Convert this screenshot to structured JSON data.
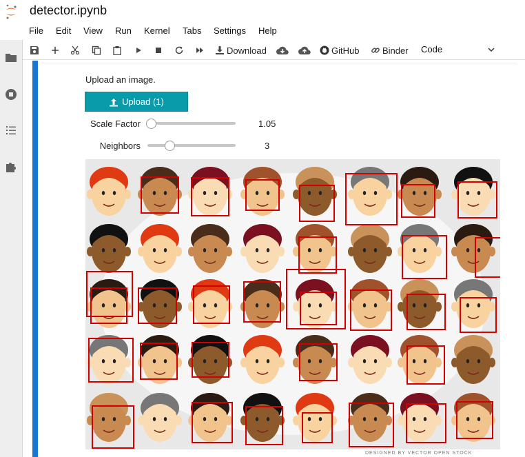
{
  "notebook": {
    "name": "detector.ipynb"
  },
  "menu": [
    "File",
    "Edit",
    "View",
    "Run",
    "Kernel",
    "Tabs",
    "Settings",
    "Help"
  ],
  "toolbar": {
    "download_label": "Download",
    "github_label": "GitHub",
    "binder_label": "Binder",
    "cell_type": "Code"
  },
  "widgets": {
    "upload_prompt": "Upload an image.",
    "upload_button_label": "Upload (1)",
    "scale_factor": {
      "label": "Scale Factor",
      "value": "1.05",
      "position": 0.0
    },
    "neighbors": {
      "label": "Neighbors",
      "value": "3",
      "position": 0.22
    }
  },
  "image": {
    "credit": "DESIGNED BY VECTOR OPEN STOCK",
    "background": "#e8e8e8",
    "detection_box_color": "#d40000"
  },
  "colors": {
    "accent": "#1976d2",
    "button": "#0a9bab",
    "sidebar": "#eeeeee"
  }
}
